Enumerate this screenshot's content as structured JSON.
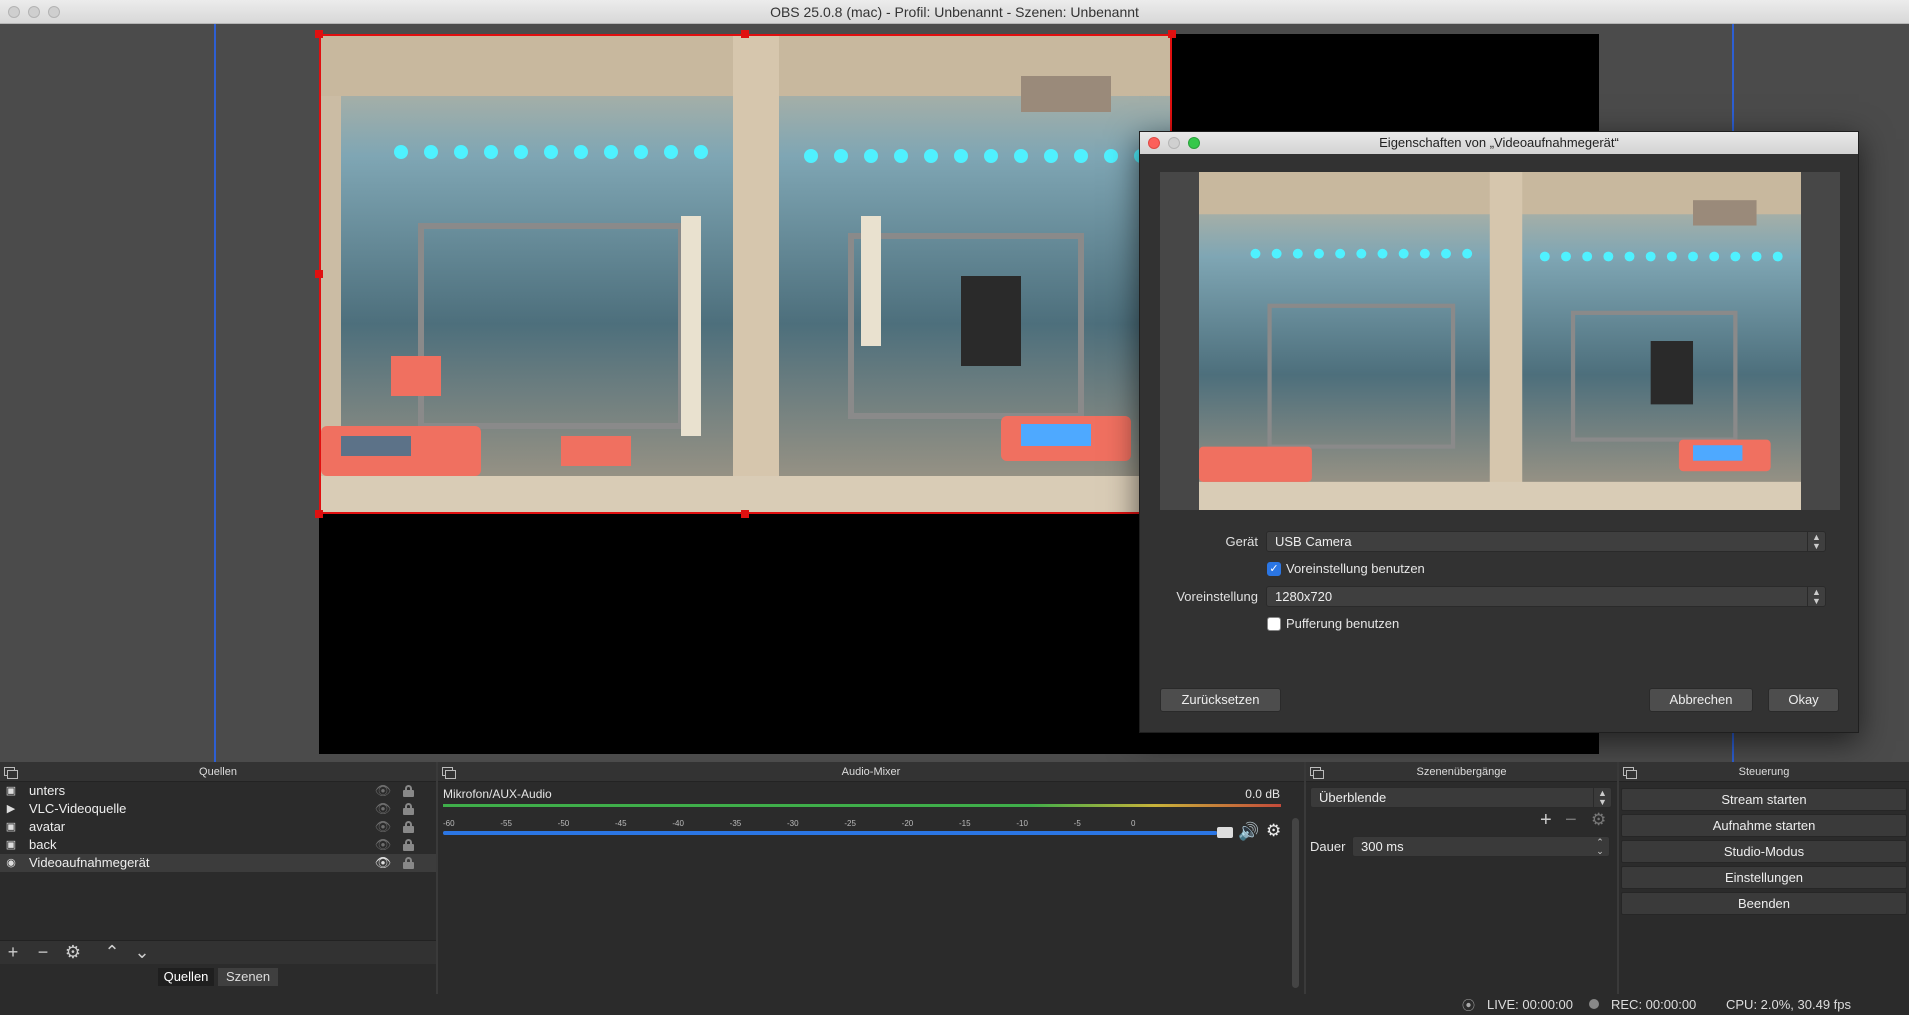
{
  "window": {
    "title": "OBS 25.0.8 (mac) - Profil: Unbenannt - Szenen: Unbenannt"
  },
  "dialog": {
    "title": "Eigenschaften von „Videoaufnahmegerät“",
    "device_label": "Gerät",
    "device_value": "USB Camera",
    "use_preset_label": "Voreinstellung benutzen",
    "use_preset_checked": true,
    "preset_label": "Voreinstellung",
    "preset_value": "1280x720",
    "use_buffering_label": "Pufferung benutzen",
    "use_buffering_checked": false,
    "reset_button": "Zurücksetzen",
    "cancel_button": "Abbrechen",
    "ok_button": "Okay"
  },
  "sources": {
    "title": "Quellen",
    "items": [
      {
        "label": "unters",
        "icon": "image-icon",
        "visible": false
      },
      {
        "label": "VLC-Videoquelle",
        "icon": "play-icon",
        "visible": false
      },
      {
        "label": "avatar",
        "icon": "image-icon",
        "visible": false
      },
      {
        "label": "back",
        "icon": "image-icon",
        "visible": false
      },
      {
        "label": "Videoaufnahmegerät",
        "icon": "camera-icon",
        "visible": true,
        "selected": true
      }
    ],
    "tab_sources": "Quellen",
    "tab_scenes": "Szenen"
  },
  "mixer": {
    "title": "Audio-Mixer",
    "channel_name": "Mikrofon/AUX-Audio",
    "level": "0.0 dB",
    "scale": [
      "-60",
      "-55",
      "-50",
      "-45",
      "-40",
      "-35",
      "-30",
      "-25",
      "-20",
      "-15",
      "-10",
      "-5",
      "0"
    ],
    "volume_fraction": 0.98
  },
  "transitions": {
    "title": "Szenenübergänge",
    "selected": "Überblende",
    "duration_label": "Dauer",
    "duration_value": "300 ms"
  },
  "controls": {
    "title": "Steuerung",
    "start_stream": "Stream starten",
    "start_recording": "Aufnahme starten",
    "studio_mode": "Studio-Modus",
    "settings": "Einstellungen",
    "exit": "Beenden"
  },
  "status": {
    "live": "LIVE: 00:00:00",
    "rec": "REC: 00:00:00",
    "cpu": "CPU: 2.0%, 30.49 fps"
  },
  "colors": {
    "selection_red": "#e01010",
    "guide_blue": "#2d5fd3",
    "checkbox_blue": "#2b76e4"
  }
}
